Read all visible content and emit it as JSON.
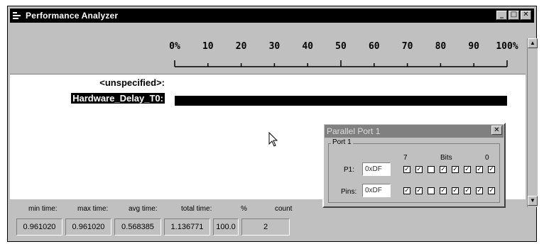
{
  "window": {
    "title": "Performance Analyzer",
    "minimize": "_",
    "maximize": "□",
    "close": "✕"
  },
  "scale": {
    "ticks": [
      "0%",
      "10",
      "20",
      "30",
      "40",
      "50",
      "60",
      "70",
      "80",
      "90",
      "100%"
    ]
  },
  "rows": [
    {
      "label": "<unspecified>:",
      "value_percent": 0
    },
    {
      "label": "Hardware_Delay_T0:",
      "value_percent": 100
    }
  ],
  "stats": {
    "headers": [
      "min time:",
      "max time:",
      "avg time:",
      "total time:",
      "%",
      "count"
    ],
    "values": [
      "0.961020",
      "0.961020",
      "0.568385",
      "1.136771",
      "100.0",
      "2"
    ]
  },
  "parallel_port": {
    "title": "Parallel Port 1",
    "close": "✕",
    "group": "Port 1",
    "bit_high": "7",
    "bits_label": "Bits",
    "bit_low": "0",
    "p1_label": "P1:",
    "p1_value": "0xDF",
    "p1_bits": [
      1,
      1,
      0,
      1,
      1,
      1,
      1,
      1
    ],
    "pins_label": "Pins:",
    "pins_value": "0xDF",
    "pins_bits": [
      1,
      1,
      0,
      1,
      1,
      1,
      1,
      1
    ]
  },
  "icons": {
    "app": "performance-analyzer-icon",
    "cursor": "mouse-pointer-icon"
  }
}
